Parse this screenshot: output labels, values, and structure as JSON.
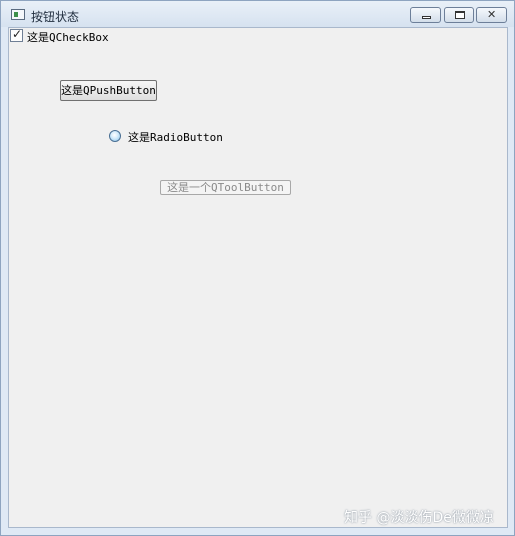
{
  "window": {
    "title": "按钮状态",
    "controls": {
      "minimize_icon": "minimize-icon",
      "maximize_icon": "maximize-icon",
      "close_icon": "close-icon",
      "close_glyph": "✕"
    }
  },
  "checkbox": {
    "label": "这是QCheckBox",
    "checked": true,
    "check_glyph": "✓"
  },
  "push_button": {
    "label": "这是QPushButton"
  },
  "radio_button": {
    "label": "这是RadioButton",
    "checked": false
  },
  "tool_button": {
    "label": "这是一个QToolButton",
    "enabled": false
  },
  "watermark": "知乎 @淡淡伤De微微凉",
  "colors": {
    "title_bar": "#dfe9f5",
    "client_bg": "#f0f0f0",
    "radio_fill": "#86c3ec",
    "disabled_text": "#8a8a8a"
  }
}
